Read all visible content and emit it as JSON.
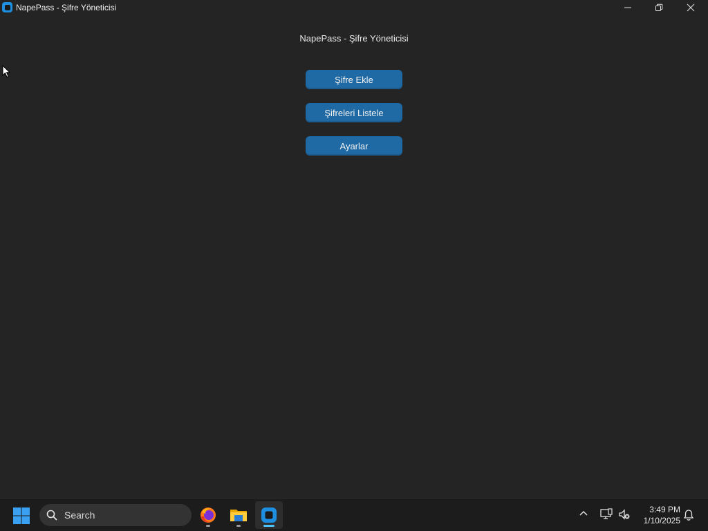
{
  "window": {
    "title": "NapePass - Şifre Yöneticisi"
  },
  "main": {
    "heading": "NapePass - Şifre Yöneticisi",
    "buttons": {
      "add_password": "Şifre Ekle",
      "list_passwords": "Şifreleri Listele",
      "settings": "Ayarlar"
    }
  },
  "taskbar": {
    "search_label": "Search",
    "clock_time": "3:49 PM",
    "clock_date": "1/10/2025",
    "apps": [
      "firefox-icon",
      "file-explorer-icon",
      "napepass-icon"
    ]
  },
  "colors": {
    "background": "#242424",
    "button": "#1f6aa5",
    "accent": "#1e8fe0",
    "taskbar": "#1c1c1c"
  }
}
